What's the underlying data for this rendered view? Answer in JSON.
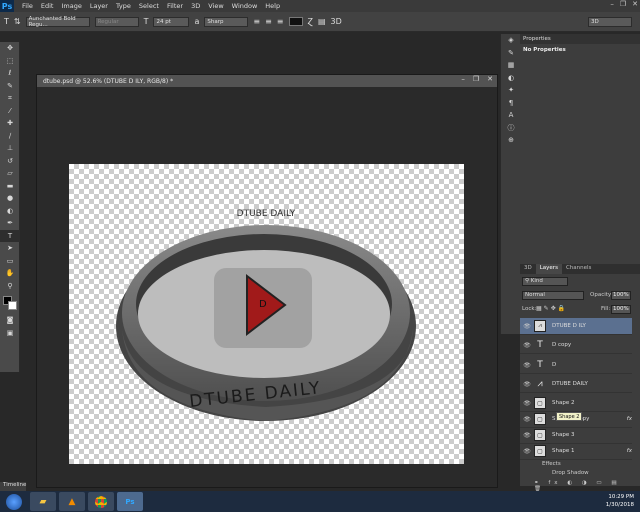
{
  "app": {
    "logo": "Ps"
  },
  "menubar": {
    "items": [
      "File",
      "Edit",
      "Image",
      "Layer",
      "Type",
      "Select",
      "Filter",
      "3D",
      "View",
      "Window",
      "Help"
    ]
  },
  "options": {
    "font_family": "Aunchanted Bold Regu...",
    "font_style": "Regular",
    "font_size": "24 pt",
    "antialias": "Sharp",
    "workspace": "3D"
  },
  "document": {
    "title": "dtube.psd @ 52.6% (DTUBE D  ILY, RGB/8) *"
  },
  "artwork": {
    "top_text": "DTUBE DAILY",
    "front_text": "DTUBE DAILY"
  },
  "properties": {
    "tab": "Properties",
    "heading": "No Properties"
  },
  "layers_panel": {
    "tabs": [
      "3D",
      "Layers",
      "Channels"
    ],
    "filter": "Kind",
    "blend": "Normal",
    "opacity_label": "Opacity:",
    "opacity": "100%",
    "lock_label": "Lock:",
    "fill_label": "Fill:",
    "fill": "100%"
  },
  "layers": [
    {
      "name": "DTUBE D  ILY",
      "kind": "text",
      "selected": true
    },
    {
      "name": "D copy",
      "kind": "text"
    },
    {
      "name": "D",
      "kind": "text"
    },
    {
      "name": "DTUBE DAILY",
      "kind": "text"
    },
    {
      "name": "Shape 2",
      "kind": "shape"
    },
    {
      "name": "Shape 2 copy",
      "kind": "shape",
      "fx": "fx"
    },
    {
      "name": "Shape 3",
      "kind": "shape"
    },
    {
      "name": "Shape 1",
      "kind": "shape",
      "fx": "fx"
    }
  ],
  "effects": {
    "label": "Effects",
    "item": "Drop Shadow"
  },
  "tooltip": "Shape 2",
  "timeline": "Timeline",
  "taskbar": {
    "time": "10:29 PM",
    "date": "1/30/2018"
  },
  "colors": {
    "accent": "#31a8ff",
    "play": "#a11a1a"
  }
}
